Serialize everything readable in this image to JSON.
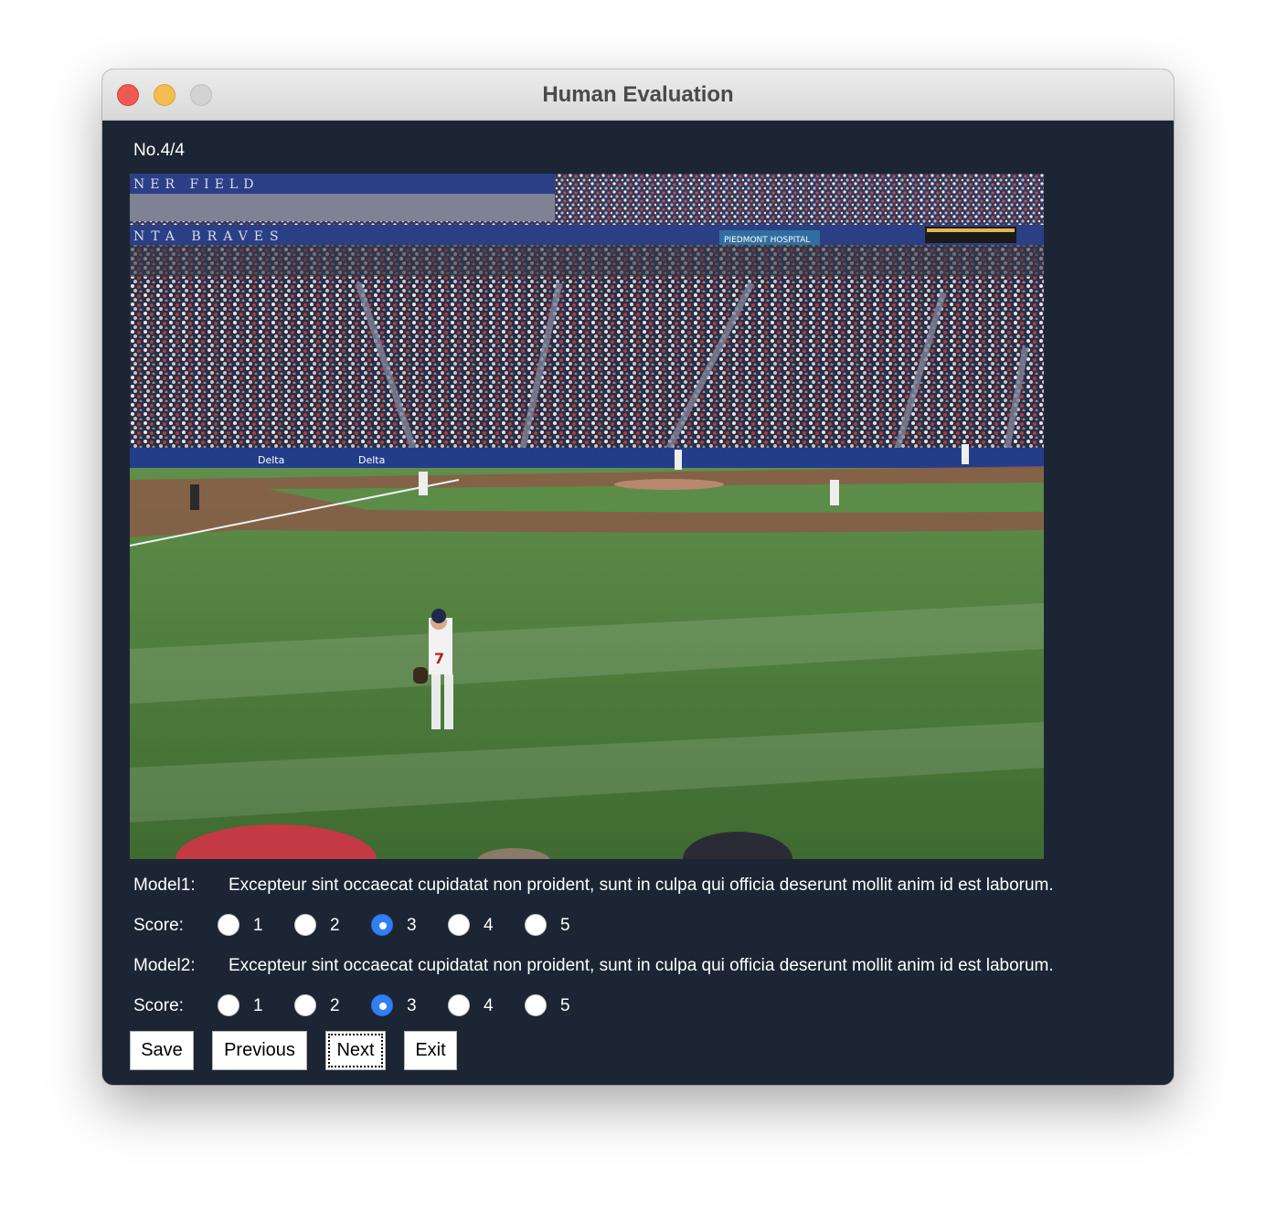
{
  "window": {
    "title": "Human Evaluation"
  },
  "counter": "No.4/4",
  "photo": {
    "stadium_banner_top": "NER FIELD",
    "stadium_banner_mid": "NTA BRAVES",
    "sponsor_left": "Delta",
    "sponsor_right": "Delta",
    "scoreboard_ad": "PIEDMONT HOSPITAL",
    "jersey_number": "7"
  },
  "model1": {
    "label": "Model1:",
    "caption": "Excepteur sint occaecat cupidatat non proident, sunt in culpa qui officia deserunt mollit anim id est laborum.",
    "score_label": "Score:",
    "options": [
      "1",
      "2",
      "3",
      "4",
      "5"
    ],
    "selected": "3"
  },
  "model2": {
    "label": "Model2:",
    "caption": "Excepteur sint occaecat cupidatat non proident, sunt in culpa qui officia deserunt mollit anim id est laborum.",
    "score_label": "Score:",
    "options": [
      "1",
      "2",
      "3",
      "4",
      "5"
    ],
    "selected": "3"
  },
  "buttons": {
    "save": "Save",
    "previous": "Previous",
    "next": "Next",
    "exit": "Exit"
  }
}
